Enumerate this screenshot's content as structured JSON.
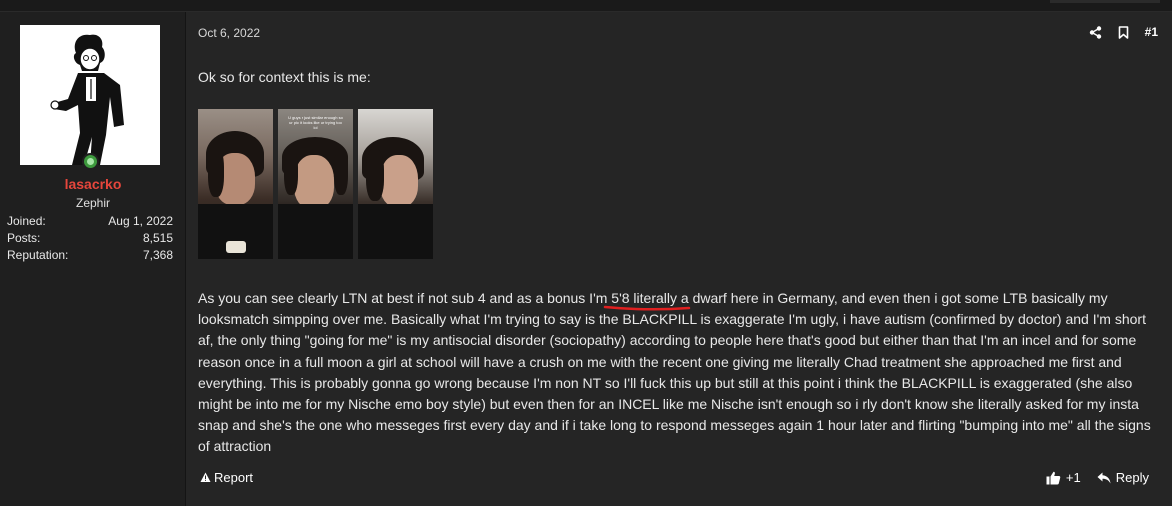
{
  "post": {
    "date": "Oct 6, 2022",
    "number": "#1",
    "intro": "Ok so for context this is me:",
    "photo_caption": "U guys r just similar enough so ur pic it looks like ur trying too lol",
    "body": "As you can see clearly LTN at best if not sub 4 and as a bonus I'm 5'8 literally a dwarf here in Germany, and even then i got some LTB basically my looksmatch simpping over me. Basically what I'm trying to say is the BLACKPILL is exaggerate I'm ugly, i have autism (confirmed by doctor) and I'm short af, the only thing \"going for me\" is my antisocial disorder (sociopathy) according to people here that's good but either than that I'm an incel and for some reason once in a full moon a girl at school will have a crush on me with the recent one giving me literally Chad treatment she approached me first and everything. This is probably gonna go wrong because I'm non NT so I'll fuck this up but still at this point i think the BLACKPILL is exaggerated (she also might be into me for my Nische emo boy style) but even then for an INCEL like me Nische isn't enough so i rly don't know she literally asked for my insta snap and she's the one who messeges first every day and if i take long to respond messeges again 1 hour later and flirting \"bumping into me\" all the signs of attraction",
    "report_label": "Report",
    "reaction_count": "+1",
    "reply_label": "Reply"
  },
  "user": {
    "name": "lasacrko",
    "title": "Zephir",
    "stats": [
      {
        "label": "Joined:",
        "value": "Aug 1, 2022"
      },
      {
        "label": "Posts:",
        "value": "8,515"
      },
      {
        "label": "Reputation:",
        "value": "7,368"
      }
    ]
  },
  "colors": {
    "username": "#e6463c",
    "online": "#3d9a3d",
    "underline": "#e02020"
  },
  "icons": {
    "share": "share-icon",
    "bookmark": "bookmark-icon",
    "report": "warning-icon",
    "like": "thumbs-up-icon",
    "reply": "reply-icon"
  }
}
